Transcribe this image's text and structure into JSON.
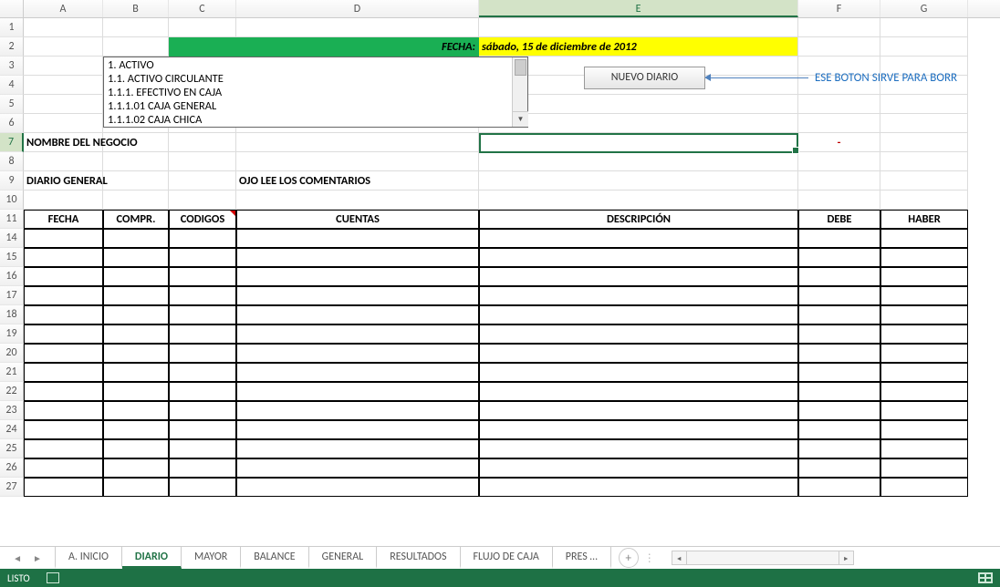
{
  "columns": [
    "A",
    "B",
    "C",
    "D",
    "E",
    "F",
    "G"
  ],
  "selected_col": "E",
  "visible_rows": [
    1,
    2,
    3,
    4,
    5,
    6,
    7,
    8,
    9,
    10,
    11,
    14,
    15,
    16,
    17,
    18,
    19,
    20,
    21,
    22,
    23,
    24,
    25,
    26,
    27
  ],
  "selected_row": 7,
  "row2": {
    "fecha_label": "FECHA:",
    "fecha_value": "sábado, 15 de diciembre de 2012"
  },
  "dropdown": {
    "items": [
      "1. ACTIVO",
      "1.1. ACTIVO CIRCULANTE",
      "1.1.1. EFECTIVO EN CAJA",
      "1.1.1.01 CAJA GENERAL",
      "1.1.1.02 CAJA CHICA"
    ]
  },
  "button_new": "NUEVO DIARIO",
  "arrow_text": "ESE BOTON SIRVE PARA BORR",
  "row7": {
    "a": "NOMBRE DEL NEGOCIO",
    "f_dash": "-"
  },
  "row9": {
    "a": "DIARIO GENERAL",
    "d": "OJO LEE LOS COMENTARIOS"
  },
  "row11": {
    "a": "FECHA",
    "b": "COMPR.",
    "c": "CODIGOS",
    "d": "CUENTAS",
    "e": "DESCRIPCIÓN",
    "f": "DEBE",
    "g": "HABER"
  },
  "tabs": {
    "items": [
      "A. INICIO",
      "DIARIO",
      "MAYOR",
      "BALANCE",
      "GENERAL",
      "RESULTADOS",
      "FLUJO DE CAJA",
      "PRES …"
    ],
    "active_index": 1
  },
  "status": {
    "ready": "LISTO"
  }
}
